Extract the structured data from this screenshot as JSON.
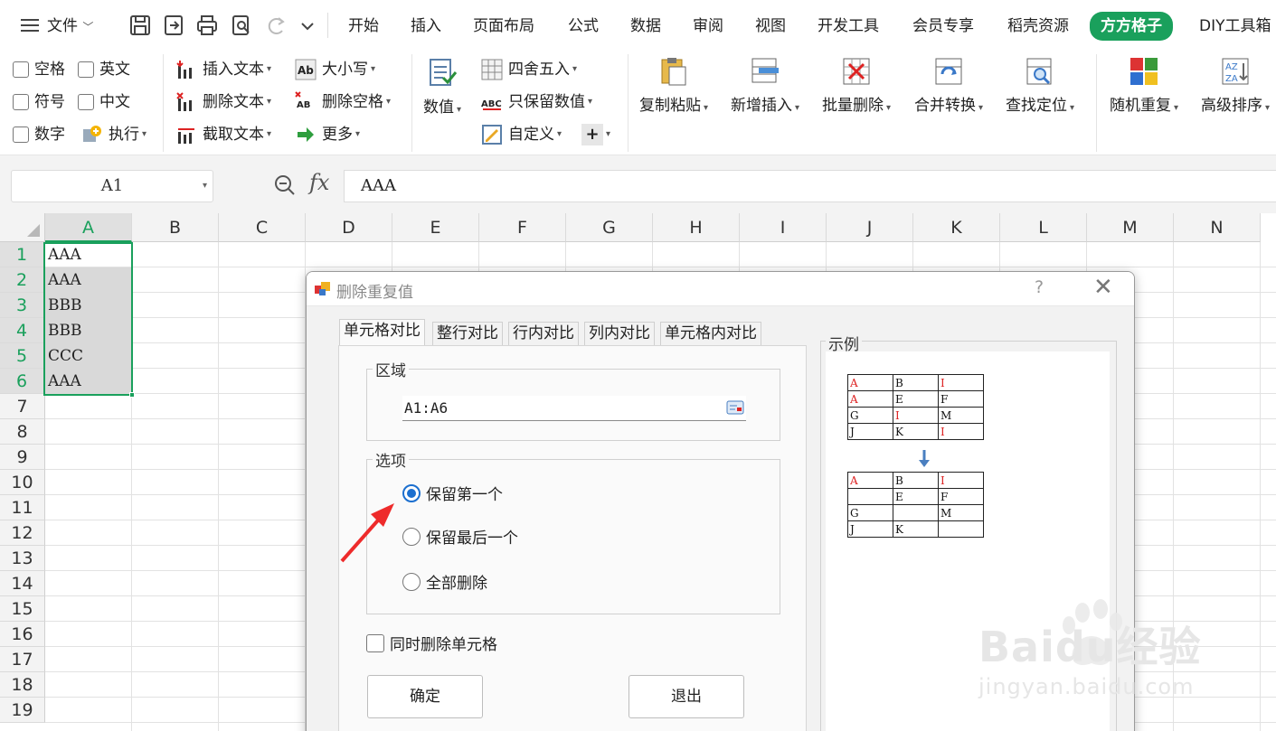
{
  "menubar": {
    "items": [
      "文件",
      "开始",
      "插入",
      "页面布局",
      "公式",
      "数据",
      "审阅",
      "视图",
      "开发工具",
      "会员专享",
      "稻壳资源",
      "方方格子",
      "DIY工具箱"
    ],
    "active_index": 11,
    "icons": [
      "menu-icon",
      "save-icon",
      "export-icon",
      "print-icon",
      "preview-icon",
      "redo-icon",
      "more-icon"
    ]
  },
  "ribbon": {
    "checks": [
      "空格",
      "英文",
      "符号",
      "中文",
      "数字"
    ],
    "execute": "执行",
    "text_ops": [
      "插入文本",
      "删除文本",
      "截取文本"
    ],
    "case_ops": [
      "大小写",
      "删除空格",
      "更多"
    ],
    "numeric": "数值",
    "round_ops": [
      "四舍五入",
      "只保留数值",
      "自定义"
    ],
    "big_buttons": [
      "复制粘贴",
      "新增插入",
      "批量删除",
      "合并转换",
      "查找定位",
      "随机重复",
      "高级排序"
    ]
  },
  "formula_bar": {
    "cell_ref": "A1",
    "fx": "fx",
    "formula": "AAA"
  },
  "grid": {
    "columns": [
      "A",
      "B",
      "C",
      "D",
      "E",
      "F",
      "G",
      "H",
      "I",
      "J",
      "K",
      "L",
      "M",
      "N"
    ],
    "rows": [
      "1",
      "2",
      "3",
      "4",
      "5",
      "6",
      "7",
      "8",
      "9",
      "10",
      "11",
      "12",
      "13",
      "14",
      "15",
      "16",
      "17",
      "18",
      "19"
    ],
    "column_a_values": [
      "AAA",
      "AAA",
      "BBB",
      "BBB",
      "CCC",
      "AAA"
    ],
    "selection": "A1:A6",
    "accent_color": "#1aa05c"
  },
  "dialog": {
    "title": "删除重复值",
    "help": "?",
    "close": "✕",
    "tabs": [
      "单元格对比",
      "整行对比",
      "行内对比",
      "列内对比",
      "单元格内对比"
    ],
    "active_tab": 0,
    "region_label": "区域",
    "range_value": "A1:A6",
    "options_label": "选项",
    "options": [
      "保留第一个",
      "保留最后一个",
      "全部删除"
    ],
    "selected_option": 0,
    "delete_cells_label": "同时删除单元格",
    "delete_cells_checked": false,
    "ok_label": "确定",
    "exit_label": "退出",
    "example_label": "示例",
    "example_before": [
      [
        "A",
        "B",
        "I"
      ],
      [
        "A",
        "E",
        "F"
      ],
      [
        "G",
        "I",
        "M"
      ],
      [
        "J",
        "K",
        "I"
      ]
    ],
    "example_after": [
      [
        "A",
        "B",
        "I"
      ],
      [
        "",
        "E",
        "F"
      ],
      [
        "G",
        "",
        "M"
      ],
      [
        "J",
        "K",
        ""
      ]
    ],
    "example_before_red": [
      [
        true,
        false,
        true
      ],
      [
        true,
        false,
        false
      ],
      [
        false,
        true,
        false
      ],
      [
        false,
        false,
        true
      ]
    ],
    "example_after_red": [
      [
        true,
        false,
        true
      ],
      [
        false,
        false,
        false
      ],
      [
        false,
        false,
        false
      ],
      [
        false,
        false,
        false
      ]
    ]
  },
  "watermark": {
    "text": "Baidu经验",
    "url": "jingyan.baidu.com"
  }
}
